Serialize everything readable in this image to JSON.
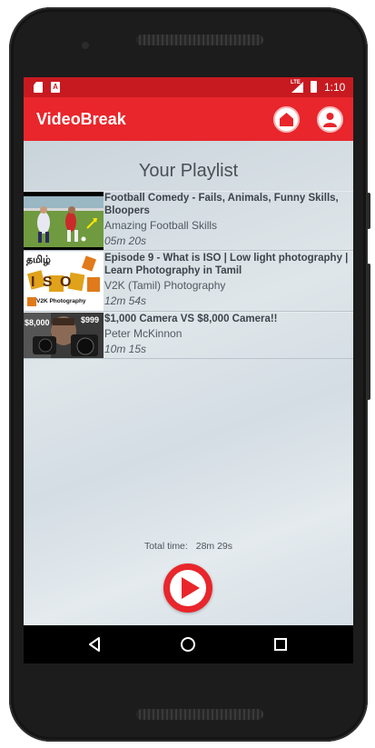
{
  "status_bar": {
    "network": "LTE",
    "time": "1:10"
  },
  "app_bar": {
    "title": "VideoBreak",
    "home_icon": "home-icon",
    "profile_icon": "user-icon"
  },
  "playlist": {
    "heading": "Your Playlist",
    "items": [
      {
        "title": "Football Comedy - Fails, Animals, Funny Skills, Bloopers",
        "channel": "Amazing Football Skills",
        "duration": "05m 20s"
      },
      {
        "title": "Episode 9 - What is ISO | Low light photography | Learn Photography in Tamil",
        "channel": "V2K (Tamil) Photography",
        "duration": "12m 54s",
        "thumb_text_top": "தமிழ்",
        "thumb_text_main": "I S O",
        "thumb_text_bottom": "V2K Photography"
      },
      {
        "title": "$1,000 Camera VS $8,000 Camera!!",
        "channel": "Peter McKinnon",
        "duration": "10m 15s",
        "thumb_price_left": "$8,000",
        "thumb_price_right": "$999"
      }
    ]
  },
  "footer": {
    "total_label": "Total time:",
    "total_value": "28m 29s",
    "play_icon": "play-icon"
  },
  "nav": {
    "back_icon": "back-icon",
    "home_icon": "circle-home-icon",
    "recents_icon": "recents-icon"
  },
  "colors": {
    "primary": "#e8262b",
    "status_bar": "#c71a20"
  }
}
